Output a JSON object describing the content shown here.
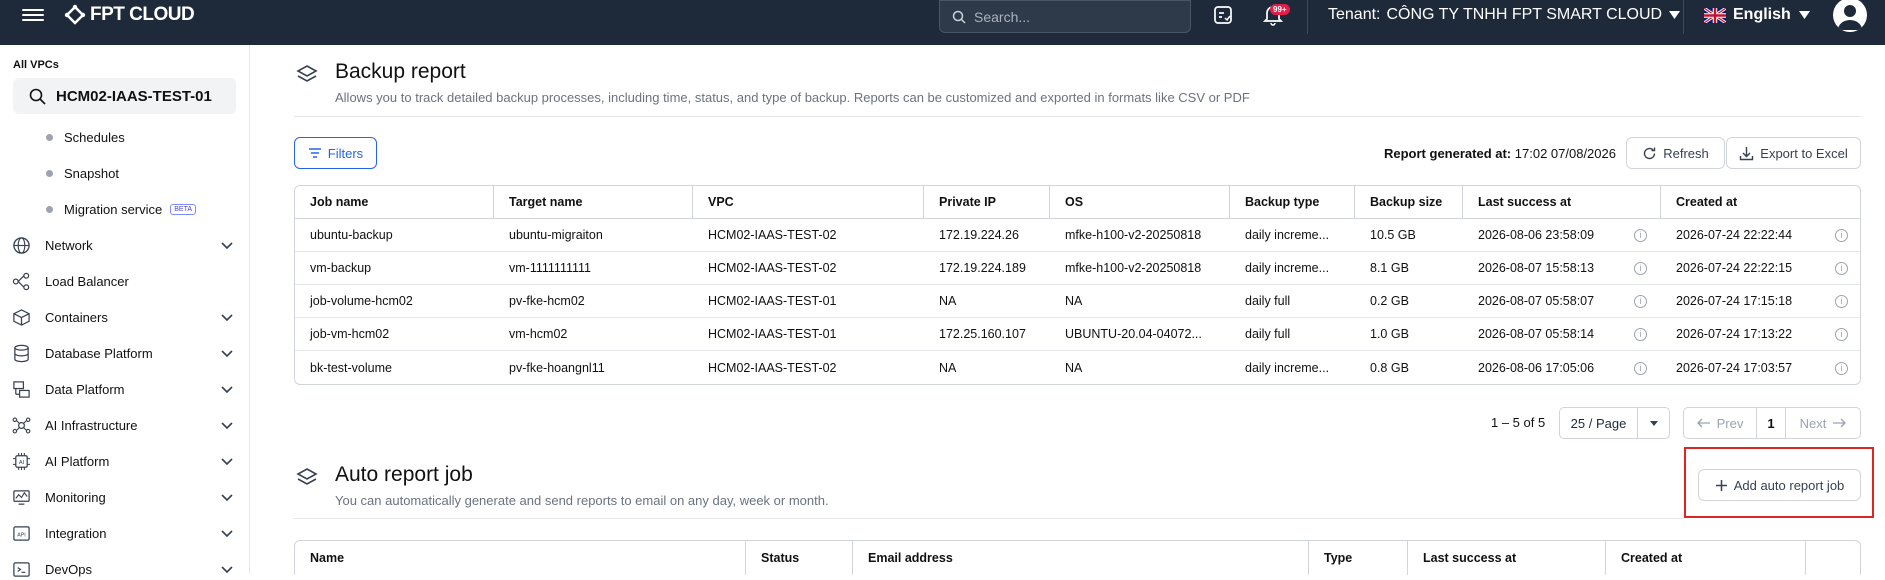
{
  "topbar": {
    "brand": "FPT CLOUD",
    "search_placeholder": "Search...",
    "notification_badge": "99+",
    "tenant_label": "Tenant:",
    "tenant_name": "CÔNG TY TNHH FPT SMART CLOUD",
    "language": "English",
    "bg_color": "#1e2a3a"
  },
  "sidebar": {
    "vpc_label": "All VPCs",
    "vpc_value": "HCM02-IAAS-TEST-01",
    "sub_items": [
      "Schedules",
      "Snapshot",
      "Migration service"
    ],
    "beta_tag": "BETA",
    "nav": [
      {
        "label": "Network",
        "icon": "globe-icon",
        "expandable": true
      },
      {
        "label": "Load Balancer",
        "icon": "load-balancer-icon",
        "expandable": false
      },
      {
        "label": "Containers",
        "icon": "cube-icon",
        "expandable": true
      },
      {
        "label": "Database Platform",
        "icon": "database-icon",
        "expandable": true
      },
      {
        "label": "Data Platform",
        "icon": "data-platform-icon",
        "expandable": true
      },
      {
        "label": "AI Infrastructure",
        "icon": "ai-infra-icon",
        "expandable": true
      },
      {
        "label": "AI Platform",
        "icon": "ai-chip-icon",
        "expandable": true
      },
      {
        "label": "Monitoring",
        "icon": "monitor-icon",
        "expandable": true
      },
      {
        "label": "Integration",
        "icon": "api-icon",
        "expandable": true
      },
      {
        "label": "DevOps",
        "icon": "devops-icon",
        "expandable": true
      }
    ]
  },
  "backup_report": {
    "title": "Backup report",
    "description": "Allows you to track detailed backup processes, including time, status, and type of backup. Reports can be customized and exported in formats like CSV or PDF",
    "filters_label": "Filters",
    "generated_label": "Report generated at:",
    "generated_value": "17:02 07/08/2026",
    "refresh_label": "Refresh",
    "export_label": "Export to Excel",
    "columns": [
      "Job name",
      "Target name",
      "VPC",
      "Private IP",
      "OS",
      "Backup type",
      "Backup size",
      "Last success at",
      "Created at"
    ],
    "rows": [
      [
        "ubuntu-backup",
        "ubuntu-migraiton",
        "HCM02-IAAS-TEST-02",
        "172.19.224.26",
        "mfke-h100-v2-20250818",
        "daily increme...",
        "10.5 GB",
        "2026-08-06 23:58:09",
        "2026-07-24 22:22:44"
      ],
      [
        "vm-backup",
        "vm-1111111111",
        "HCM02-IAAS-TEST-02",
        "172.19.224.189",
        "mfke-h100-v2-20250818",
        "daily increme...",
        "8.1 GB",
        "2026-08-07 15:58:13",
        "2026-07-24 22:22:15"
      ],
      [
        "job-volume-hcm02",
        "pv-fke-hcm02",
        "HCM02-IAAS-TEST-01",
        "NA",
        "NA",
        "daily full",
        "0.2 GB",
        "2026-08-07 05:58:07",
        "2026-07-24 17:15:18"
      ],
      [
        "job-vm-hcm02",
        "vm-hcm02",
        "HCM02-IAAS-TEST-01",
        "172.25.160.107",
        "UBUNTU-20.04-04072...",
        "daily full",
        "1.0 GB",
        "2026-08-07 05:58:14",
        "2026-07-24 17:13:22"
      ],
      [
        "bk-test-volume",
        "pv-fke-hoangnl11",
        "HCM02-IAAS-TEST-02",
        "NA",
        "NA",
        "daily increme...",
        "0.8 GB",
        "2026-08-06 17:05:06",
        "2026-07-24 17:03:57"
      ]
    ],
    "pagination": {
      "summary": "1 – 5 of 5",
      "per_page": "25 / Page",
      "prev": "Prev",
      "page": "1",
      "next": "Next"
    }
  },
  "auto_report": {
    "title": "Auto report job",
    "description": "You can automatically generate and send reports to email on any day, week or month.",
    "add_label": "Add auto report job",
    "columns": [
      "Name",
      "Status",
      "Email address",
      "Type",
      "Last success at",
      "Created at",
      ""
    ]
  },
  "colors": {
    "accent": "#2563eb",
    "highlight": "#dc2626"
  }
}
